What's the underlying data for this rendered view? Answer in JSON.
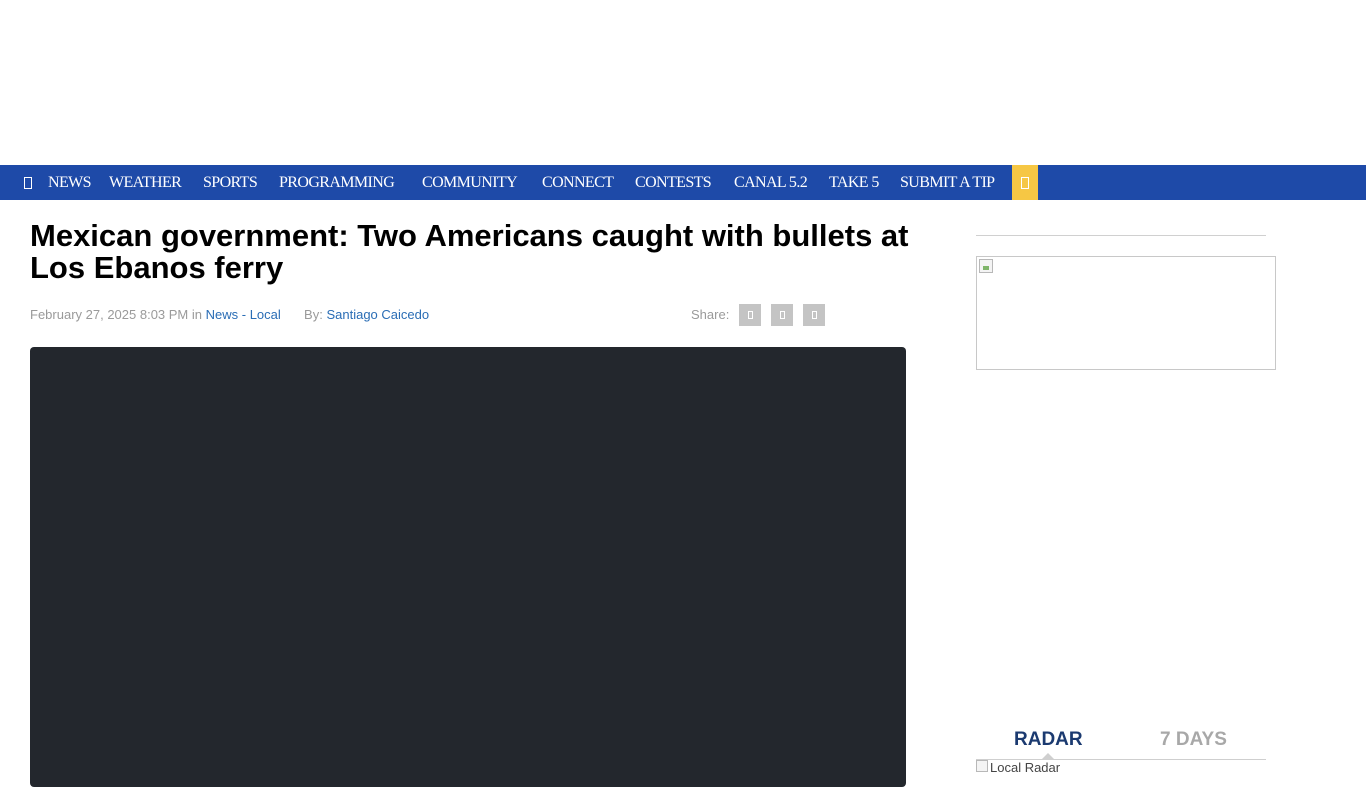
{
  "nav": {
    "items": [
      "NEWS",
      "WEATHER",
      "SPORTS",
      "PROGRAMMING",
      "COMMUNITY",
      "CONNECT",
      "CONTESTS",
      "CANAL 5.2",
      "TAKE 5",
      "SUBMIT A TIP"
    ],
    "bar_color": "#1e4aa8",
    "search_color": "#f6c744",
    "menu_icon": "menu-icon",
    "search_icon": "search-icon"
  },
  "article": {
    "headline": "Mexican government: Two Americans caught with bullets at Los Ebanos ferry",
    "date": "February 27, 2025 8:03 PM",
    "in_label": "in",
    "category": "News - Local",
    "by_label": "By:",
    "author": "Santiago Caicedo",
    "share_label": "Share:",
    "share_icons": [
      "facebook-icon",
      "twitter-icon",
      "email-icon"
    ]
  },
  "sidebar": {
    "weather_tabs": [
      {
        "label": "RADAR",
        "active": true
      },
      {
        "label": "7 DAYS",
        "active": false
      }
    ],
    "radar_alt": "Local Radar"
  }
}
